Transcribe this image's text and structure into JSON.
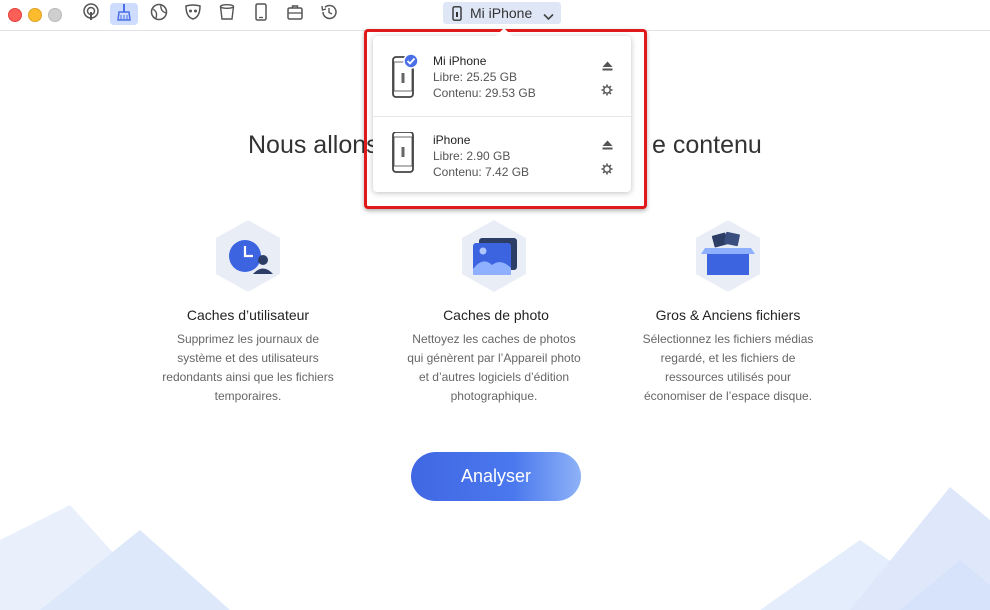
{
  "window": {
    "controls": [
      "close",
      "minimize",
      "zoom"
    ]
  },
  "toolbar": {
    "tools": [
      {
        "icon": "podcast-icon",
        "active": false
      },
      {
        "icon": "broom-icon",
        "active": true
      },
      {
        "icon": "compass-icon",
        "active": false
      },
      {
        "icon": "mask-icon",
        "active": false
      },
      {
        "icon": "bucket-icon",
        "active": false
      },
      {
        "icon": "device-icon",
        "active": false
      },
      {
        "icon": "briefcase-icon",
        "active": false
      },
      {
        "icon": "history-icon",
        "active": false
      }
    ],
    "device_selector": {
      "label": "Mi iPhone",
      "icon": "iphone-icon",
      "chevron": "chevron-down-icon"
    }
  },
  "main": {
    "headline_left": "Nous allons",
    "headline_right": "e contenu",
    "features": [
      {
        "title": "Caches d’utilisateur",
        "desc": [
          "Supprimez les journaux de",
          "système et des utilisateurs",
          "redondants ainsi que les fichiers",
          "temporaires."
        ],
        "icon": "user-clock-icon"
      },
      {
        "title": "Caches de photo",
        "desc": [
          "Nettoyez les caches de photos",
          "qui génèrent par l’Appareil photo",
          "et d’autres logiciels d’édition",
          "photographique."
        ],
        "icon": "photo-icon"
      },
      {
        "title": "Gros & Anciens fichiers",
        "desc": [
          "Sélectionnez les fichiers médias",
          "regardé, et les fichiers de",
          "ressources utilisés pour",
          "économiser de l’espace disque."
        ],
        "icon": "box-icon"
      }
    ],
    "analyze_button": "Analyser"
  },
  "device_popup": {
    "devices": [
      {
        "name": "Mi iPhone",
        "free": "Libre: 25.25 GB",
        "content": "Contenu: 29.53 GB",
        "selected": true
      },
      {
        "name": "iPhone",
        "free": "Libre: 2.90 GB",
        "content": "Contenu: 7.42 GB",
        "selected": false
      }
    ]
  },
  "colors": {
    "accent": "#4a6fe6",
    "highlight": "#e01a1a",
    "mountain": "#e6eefc"
  }
}
